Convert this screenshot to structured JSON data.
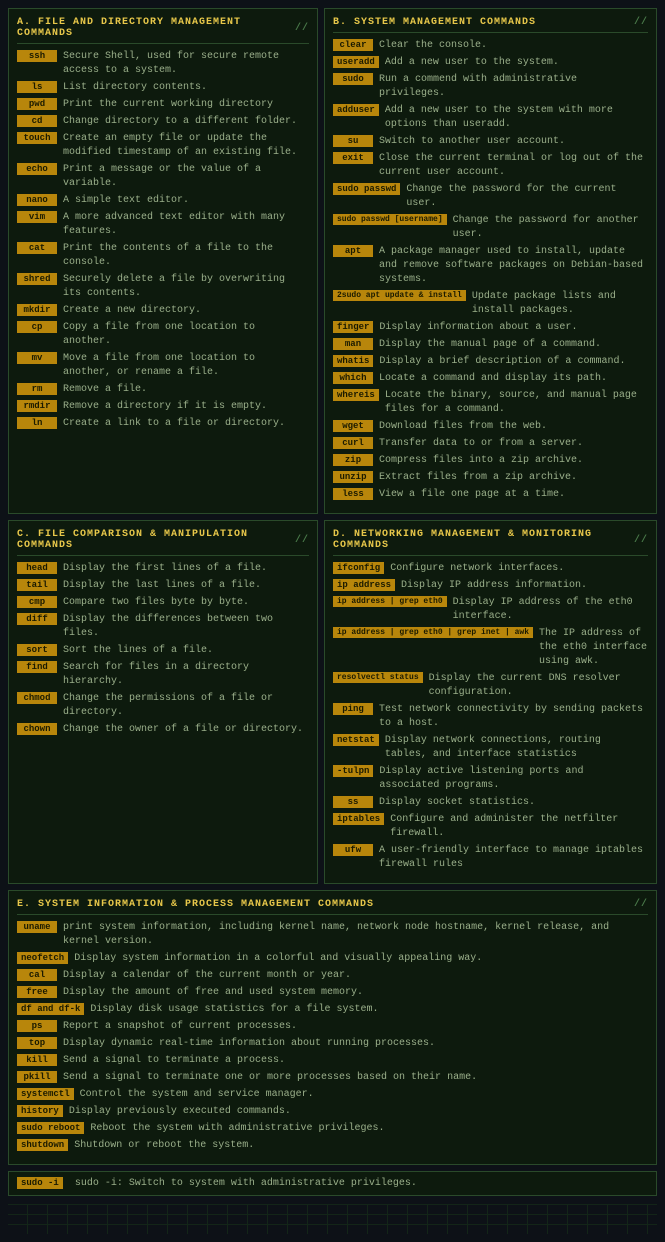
{
  "sections": {
    "a": {
      "title": "A. FILE AND DIRECTORY MANAGEMENT COMMANDS",
      "commands": [
        {
          "cmd": "ssh",
          "desc": "Secure Shell, used for secure remote access to a system."
        },
        {
          "cmd": "ls",
          "desc": "List directory contents."
        },
        {
          "cmd": "pwd",
          "desc": "Print the current working directory"
        },
        {
          "cmd": "cd",
          "desc": "Change directory to a different folder."
        },
        {
          "cmd": "touch",
          "desc": "Create an empty file or update the modified timestamp of an existing file."
        },
        {
          "cmd": "echo",
          "desc": "Print a message or the value of a variable."
        },
        {
          "cmd": "nano",
          "desc": "A simple text editor."
        },
        {
          "cmd": "vim",
          "desc": "A more advanced text editor with many features."
        },
        {
          "cmd": "cat",
          "desc": "Print the contents of a file to the console."
        },
        {
          "cmd": "shred",
          "desc": "Securely delete a file by overwriting its contents."
        },
        {
          "cmd": "mkdir",
          "desc": "Create a new directory."
        },
        {
          "cmd": "cp",
          "desc": "Copy a file from one location to another."
        },
        {
          "cmd": "mv",
          "desc": "Move a file from one location to another, or rename a file."
        },
        {
          "cmd": "rm",
          "desc": "Remove a file."
        },
        {
          "cmd": "rmdir",
          "desc": "Remove a directory if it is empty."
        },
        {
          "cmd": "ln",
          "desc": "Create a link to a file or directory."
        }
      ]
    },
    "b": {
      "title": "B. SYSTEM MANAGEMENT COMMANDS",
      "commands": [
        {
          "cmd": "clear",
          "desc": "Clear the console."
        },
        {
          "cmd": "useradd",
          "desc": "Add a new user to the system."
        },
        {
          "cmd": "sudo",
          "desc": "Run a commend with administrative privileges."
        },
        {
          "cmd": "adduser",
          "desc": "Add a new user to the system with more options than useradd."
        },
        {
          "cmd": "su",
          "desc": "Switch to another user account."
        },
        {
          "cmd": "exit",
          "desc": "Close the current terminal or log out of the current user account."
        },
        {
          "cmd": "sudo passwd",
          "desc": "Change the password for the current user."
        },
        {
          "cmd": "sudo passwd [username]",
          "desc": "Change the password for another user."
        },
        {
          "cmd": "apt",
          "desc": "A package manager used to install, update and remove software packages on Debian-based systems."
        },
        {
          "cmd": "2sudo apt update & install",
          "desc": "Update package lists and install packages."
        },
        {
          "cmd": "finger",
          "desc": "Display information about a user."
        },
        {
          "cmd": "man",
          "desc": "Display the manual page of a command."
        },
        {
          "cmd": "whatis",
          "desc": "Display a brief description of a command."
        },
        {
          "cmd": "which",
          "desc": "Locate a command and display its path."
        },
        {
          "cmd": "whereis",
          "desc": "Locate the binary, source, and manual page files for a command."
        },
        {
          "cmd": "wget",
          "desc": "Download files from the web."
        },
        {
          "cmd": "curl",
          "desc": "Transfer data to or from a server."
        },
        {
          "cmd": "zip",
          "desc": "Compress files into a zip archive."
        },
        {
          "cmd": "unzip",
          "desc": "Extract files from a zip archive."
        },
        {
          "cmd": "less",
          "desc": "View a file one page at a time."
        }
      ]
    },
    "c": {
      "title": "C. FILE COMPARISON & MANIPULATION COMMANDS",
      "commands": [
        {
          "cmd": "head",
          "desc": "Display the first lines of a file."
        },
        {
          "cmd": "tail",
          "desc": "Display the last lines of a file."
        },
        {
          "cmd": "cmp",
          "desc": "Compare two files byte by byte."
        },
        {
          "cmd": "diff",
          "desc": "Display the differences between two files."
        },
        {
          "cmd": "sort",
          "desc": "Sort the lines of a file."
        },
        {
          "cmd": "find",
          "desc": "Search for files in a directory hierarchy."
        },
        {
          "cmd": "chmod",
          "desc": "Change the permissions of a file or directory."
        },
        {
          "cmd": "chown",
          "desc": "Change the owner of a file or directory."
        }
      ]
    },
    "d": {
      "title": "D. NETWORKING MANAGEMENT & MONITORING COMMANDS",
      "commands": [
        {
          "cmd": "ifconfig",
          "desc": "Configure network interfaces."
        },
        {
          "cmd": "ip address",
          "desc": "Display IP address information."
        },
        {
          "cmd": "ip address | grep eth0",
          "desc": "Display IP address of the eth0 interface."
        },
        {
          "cmd": "ip address | grep eth0 | grep inet | awk",
          "desc": "The IP address of the eth0 interface using awk."
        },
        {
          "cmd": "resolvectl status",
          "desc": "Display the current DNS resolver configuration."
        },
        {
          "cmd": "ping",
          "desc": "Test network connectivity by sending packets to a host."
        },
        {
          "cmd": "netstat",
          "desc": "Display network connections, routing tables, and interface statistics"
        },
        {
          "cmd": "-tulpn",
          "desc": "Display active listening ports and associated programs."
        },
        {
          "cmd": "ss",
          "desc": "Display socket statistics."
        },
        {
          "cmd": "iptables",
          "desc": "Configure and administer the netfilter firewall."
        },
        {
          "cmd": "ufw",
          "desc": "A user-friendly interface to manage iptables firewall rules"
        }
      ]
    },
    "e": {
      "title": "E. SYSTEM INFORMATION & PROCESS MANAGEMENT COMMANDS",
      "commands": [
        {
          "cmd": "uname",
          "desc": "print system information, including kernel name, network node hostname, kernel release, and kernel version."
        },
        {
          "cmd": "neofetch",
          "desc": "Display system information in a colorful and visually appealing way."
        },
        {
          "cmd": "cal",
          "desc": "Display a calendar of the current month or year."
        },
        {
          "cmd": "free",
          "desc": "Display the amount of free and used system memory."
        },
        {
          "cmd": "df and df-k",
          "desc": "Display disk usage statistics for a file system."
        },
        {
          "cmd": "ps",
          "desc": "Report a snapshot of current processes."
        },
        {
          "cmd": "top",
          "desc": "Display dynamic real-time information about running processes."
        },
        {
          "cmd": "kill",
          "desc": "Send a signal to  terminate a process."
        },
        {
          "cmd": "pkill",
          "desc": "Send a signal to terminate one or more processes based on their name."
        },
        {
          "cmd": "systemctl",
          "desc": "Control the system and service manager."
        },
        {
          "cmd": "history",
          "desc": "Display previously executed commands."
        },
        {
          "cmd": "sudo reboot",
          "desc": "Reboot the system with administrative privileges."
        },
        {
          "cmd": "shutdown",
          "desc": "Shutdown or reboot the system."
        }
      ]
    }
  },
  "footer": {
    "text": "sudo -i: Switch to system with administrative privileges."
  }
}
